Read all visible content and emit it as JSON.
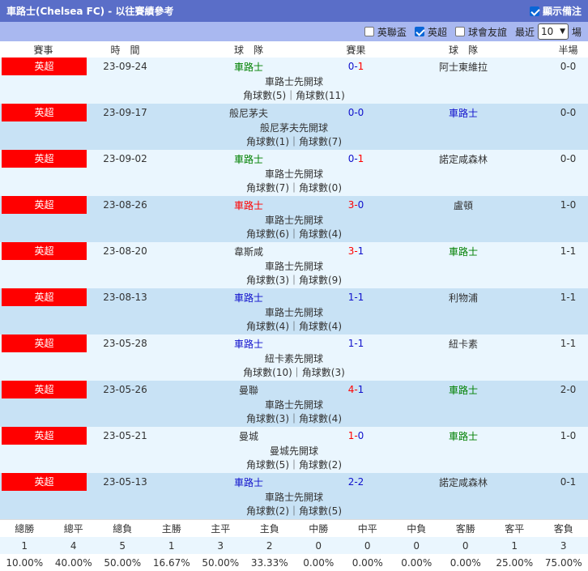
{
  "title": "車路士(Chelsea FC) - 以往賽績參考",
  "show_notes_label": "顯示備注",
  "filters": {
    "league_cup": "英聯盃",
    "premier": "英超",
    "club_friendly": "球會友誼",
    "recent_label": "最近",
    "recent_value": "10",
    "matches_label": "場"
  },
  "headers": [
    "賽事",
    "時　間",
    "球　隊",
    "賽果",
    "球　隊",
    "半場"
  ],
  "matches": [
    {
      "league": "英超",
      "date": "23-09-24",
      "home": "車路士",
      "home_color": "green",
      "score_a": "0",
      "score_b": "1",
      "score_color": "blue-red",
      "away": "阿士東維拉",
      "away_color": "dark",
      "half": "0-0",
      "kickoff": "車路士先開球",
      "corners": "角球數(5)｜角球數(11)"
    },
    {
      "league": "英超",
      "date": "23-09-17",
      "home": "般尼茅夫",
      "home_color": "dark",
      "score_a": "0",
      "score_b": "0",
      "score_color": "blue",
      "away": "車路士",
      "away_color": "blue",
      "half": "0-0",
      "kickoff": "般尼茅夫先開球",
      "corners": "角球數(1)｜角球數(7)"
    },
    {
      "league": "英超",
      "date": "23-09-02",
      "home": "車路士",
      "home_color": "green",
      "score_a": "0",
      "score_b": "1",
      "score_color": "blue-red",
      "away": "諾定咸森林",
      "away_color": "dark",
      "half": "0-0",
      "kickoff": "車路士先開球",
      "corners": "角球數(7)｜角球數(0)"
    },
    {
      "league": "英超",
      "date": "23-08-26",
      "home": "車路士",
      "home_color": "red",
      "score_a": "3",
      "score_b": "0",
      "score_color": "red-blue",
      "away": "盧頓",
      "away_color": "dark",
      "half": "1-0",
      "kickoff": "車路士先開球",
      "corners": "角球數(6)｜角球數(4)"
    },
    {
      "league": "英超",
      "date": "23-08-20",
      "home": "韋斯咸",
      "home_color": "dark",
      "score_a": "3",
      "score_b": "1",
      "score_color": "red-blue",
      "away": "車路士",
      "away_color": "green",
      "half": "1-1",
      "kickoff": "車路士先開球",
      "corners": "角球數(3)｜角球數(9)"
    },
    {
      "league": "英超",
      "date": "23-08-13",
      "home": "車路士",
      "home_color": "blue",
      "score_a": "1",
      "score_b": "1",
      "score_color": "blue",
      "away": "利物浦",
      "away_color": "dark",
      "half": "1-1",
      "kickoff": "車路士先開球",
      "corners": "角球數(4)｜角球數(4)"
    },
    {
      "league": "英超",
      "date": "23-05-28",
      "home": "車路士",
      "home_color": "blue",
      "score_a": "1",
      "score_b": "1",
      "score_color": "blue",
      "away": "紐卡素",
      "away_color": "dark",
      "half": "1-1",
      "kickoff": "紐卡素先開球",
      "corners": "角球數(10)｜角球數(3)"
    },
    {
      "league": "英超",
      "date": "23-05-26",
      "home": "曼聯",
      "home_color": "dark",
      "score_a": "4",
      "score_b": "1",
      "score_color": "red-blue",
      "away": "車路士",
      "away_color": "green",
      "half": "2-0",
      "kickoff": "車路士先開球",
      "corners": "角球數(3)｜角球數(4)"
    },
    {
      "league": "英超",
      "date": "23-05-21",
      "home": "曼城",
      "home_color": "dark",
      "score_a": "1",
      "score_b": "0",
      "score_color": "red-blue",
      "away": "車路士",
      "away_color": "green",
      "half": "1-0",
      "kickoff": "曼城先開球",
      "corners": "角球數(5)｜角球數(2)"
    },
    {
      "league": "英超",
      "date": "23-05-13",
      "home": "車路士",
      "home_color": "blue",
      "score_a": "2",
      "score_b": "2",
      "score_color": "blue",
      "away": "諾定咸森林",
      "away_color": "dark",
      "half": "0-1",
      "kickoff": "車路士先開球",
      "corners": "角球數(2)｜角球數(5)"
    }
  ],
  "stats": {
    "labels": [
      "總勝",
      "總平",
      "總負",
      "主勝",
      "主平",
      "主負",
      "中勝",
      "中平",
      "中負",
      "客勝",
      "客平",
      "客負"
    ],
    "counts": [
      "1",
      "4",
      "5",
      "1",
      "3",
      "2",
      "0",
      "0",
      "0",
      "0",
      "1",
      "3"
    ],
    "percents": [
      "10.00%",
      "40.00%",
      "50.00%",
      "16.67%",
      "50.00%",
      "33.33%",
      "0.00%",
      "0.00%",
      "0.00%",
      "0.00%",
      "25.00%",
      "75.00%"
    ]
  }
}
